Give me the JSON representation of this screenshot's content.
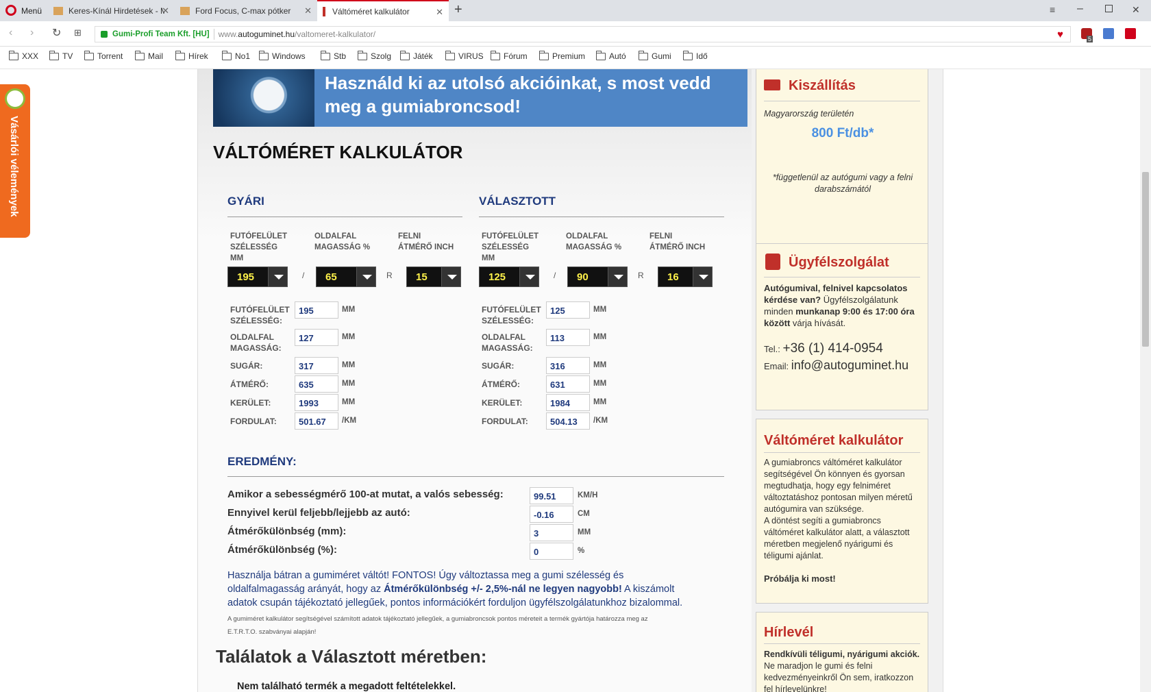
{
  "browser": {
    "menu_label": "Menü",
    "tabs": [
      "Keres-Kínál Hirdetések - M",
      "Ford Focus, C-max pótker",
      "Váltóméret kalkulátor"
    ],
    "site_identity": "Gumi-Profi Team Kft. [HU]",
    "url_prefix": "www.",
    "url_domain": "autoguminet.hu",
    "url_path": "/valtomeret-kalkulator/",
    "ext_badge": "5",
    "bookmarks": [
      "XXX",
      "TV",
      "Torrent",
      "Mail",
      "Hírek",
      "No1",
      "Windows",
      "Stb",
      "Szolg",
      "Játék",
      "VIRUS",
      "Fórum",
      "Premium",
      "Autó",
      "Gumi",
      "Idő"
    ]
  },
  "side_tab": "Vásárlói vélemények",
  "banner": {
    "line1": "Használd ki az utolsó akcióinkat, s most vedd",
    "line2": "meg a gumiabroncsod!"
  },
  "page_title": "VÁLTÓMÉRET KALKULÁTOR",
  "gyari": {
    "heading": "GYÁRI",
    "col_labels": [
      [
        "FUTÓFELÜLET",
        "SZÉLESSÉG",
        "MM"
      ],
      [
        "OLDALFAL",
        "MAGASSÁG %"
      ],
      [
        "FELNI",
        "ÁTMÉRŐ INCH"
      ]
    ],
    "selects": [
      "195",
      "65",
      "15"
    ],
    "rows": [
      {
        "label": [
          "FUTÓFELÜLET",
          "SZÉLESSÉG:"
        ],
        "value": "195",
        "unit": "MM"
      },
      {
        "label": [
          "OLDALFAL",
          "MAGASSÁG:"
        ],
        "value": "127",
        "unit": "MM"
      },
      {
        "label": [
          "SUGÁR:"
        ],
        "value": "317",
        "unit": "MM"
      },
      {
        "label": [
          "ÁTMÉRŐ:"
        ],
        "value": "635",
        "unit": "MM"
      },
      {
        "label": [
          "KERÜLET:"
        ],
        "value": "1993",
        "unit": "MM"
      },
      {
        "label": [
          "FORDULAT:"
        ],
        "value": "501.67",
        "unit": "/KM"
      }
    ]
  },
  "valasztott": {
    "heading": "VÁLASZTOTT",
    "col_labels": [
      [
        "FUTÓFELÜLET",
        "SZÉLESSÉG",
        "MM"
      ],
      [
        "OLDALFAL",
        "MAGASSÁG %"
      ],
      [
        "FELNI",
        "ÁTMÉRŐ INCH"
      ]
    ],
    "selects": [
      "125",
      "90",
      "16"
    ],
    "rows": [
      {
        "label": [
          "FUTÓFELÜLET",
          "SZÉLESSÉG:"
        ],
        "value": "125",
        "unit": "MM"
      },
      {
        "label": [
          "OLDALFAL",
          "MAGASSÁG:"
        ],
        "value": "113",
        "unit": "MM"
      },
      {
        "label": [
          "SUGÁR:"
        ],
        "value": "316",
        "unit": "MM"
      },
      {
        "label": [
          "ÁTMÉRŐ:"
        ],
        "value": "631",
        "unit": "MM"
      },
      {
        "label": [
          "KERÜLET:"
        ],
        "value": "1984",
        "unit": "MM"
      },
      {
        "label": [
          "FORDULAT:"
        ],
        "value": "504.13",
        "unit": "/KM"
      }
    ]
  },
  "sep_slash": "/",
  "sep_r": "R",
  "eredmeny": {
    "heading": "EREDMÉNY:",
    "rows": [
      {
        "label": "Amikor a sebességmérő 100-at mutat, a valós sebesség:",
        "value": "99.51",
        "unit": "KM/H"
      },
      {
        "label": "Ennyivel kerül feljebb/lejjebb az autó:",
        "value": "-0.16",
        "unit": "CM"
      },
      {
        "label": "Átmérőkülönbség (mm):",
        "value": "3",
        "unit": "MM"
      },
      {
        "label": "Átmérőkülönbség (%):",
        "value": "0",
        "unit": "%"
      }
    ]
  },
  "info": {
    "p1a": "Használja bátran a gumiméret váltót! FONTOS! Úgy változtassa meg a gumi szélesség és",
    "p1b_pre": "oldalfalmagasság arányát, hogy az ",
    "p1b_bold": "Átmérőkülönbség +/- 2,5%-nál ne legyen nagyobb!",
    "p1b_post": " A kiszámolt",
    "p1c": "adatok csupán tájékoztató jellegűek, pontos információkért forduljon ügyfélszolgálatunkhoz bizalommal.",
    "small1": "A gumiméret kalkulátor segítségével számított adatok tájékoztató jellegűek, a gumiabroncsok pontos méreteit a termék gyártója határozza meg az",
    "small2": "E.T.R.T.O. szabványai alapján!"
  },
  "results_title": "Találatok a Választott méretben:",
  "no_results": "Nem található termék a megadott feltételekkel.",
  "sidebar": {
    "shipping": {
      "title": "Kiszállítás",
      "region": "Magyarország területén",
      "price": "800 Ft/db*",
      "note1": "*függetlenül az autógumi vagy a felni",
      "note2": "darabszámától"
    },
    "support": {
      "title": "Ügyfélszolgálat",
      "q": "Autógumival, felnivel kapcsolatos kérdése van?",
      "t1": " Ügyfélszolgálatunk minden ",
      "hours": "munkanap 9:00 és 17:00 óra között",
      "t2": " várja hívását.",
      "tel_label": "Tel.: ",
      "tel": "+36 (1) 414-0954",
      "email_label": "Email: ",
      "email": "info@autoguminet.hu"
    },
    "calc": {
      "title": "Váltóméret kalkulátor",
      "p1": "A gumiabroncs váltóméret kalkulátor segítségével Ön könnyen és gyorsan megtudhatja, hogy egy felniméret változtatáshoz pontosan milyen méretű autógumira van szüksége.",
      "p2": "A döntést segíti a gumiabroncs váltóméret kalkulátor alatt, a választott méretben megjelenő nyárigumi és téligumi ajánlat.",
      "cta": "Próbálja ki most!"
    },
    "news": {
      "title": "Hírlevél",
      "bold": "Rendkívüli téligumi, nyárigumi akciók.",
      "text": " Ne maradjon le gumi és felni kedvezményeinkről Ön sem, iratkozzon fel hírlevelünkre!"
    }
  },
  "colors": {
    "accent_red": "#c0302a",
    "heading_blue": "#1f3a7d",
    "price_blue": "#4a90e2",
    "side_tab_orange": "#ef6a1f"
  }
}
